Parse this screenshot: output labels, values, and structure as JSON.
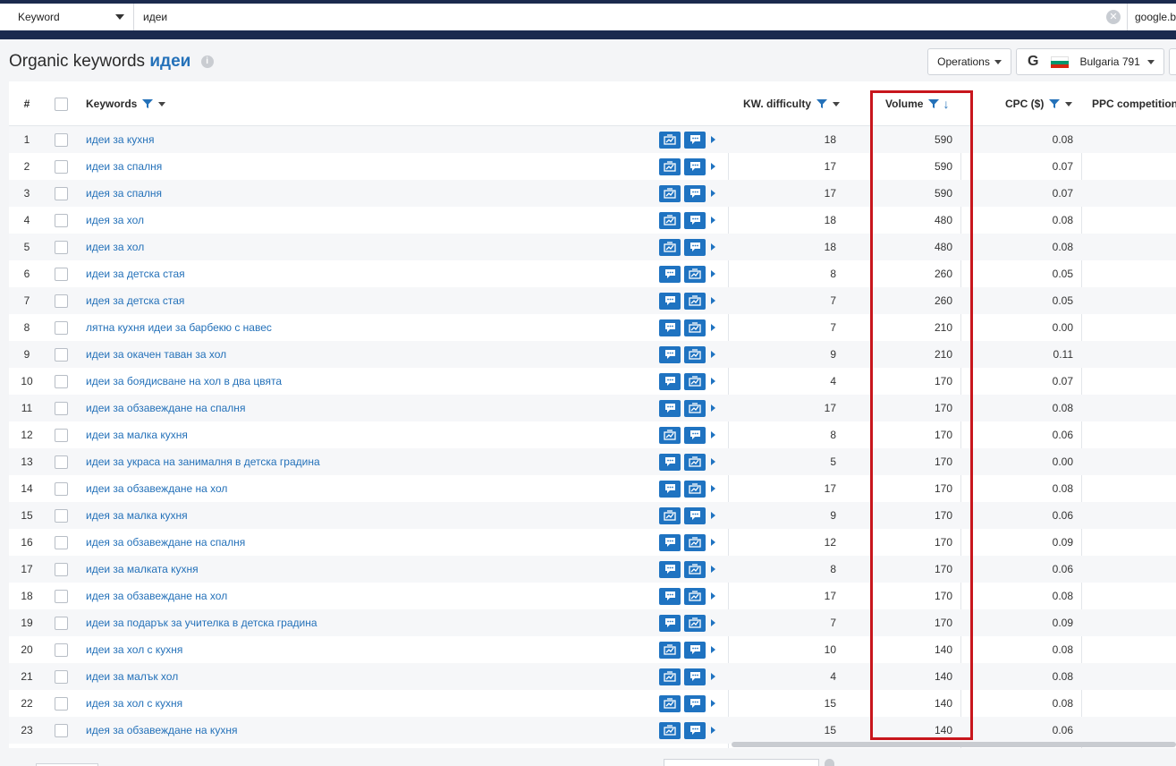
{
  "search": {
    "type_label": "Keyword",
    "query": "идеи",
    "engine_partial": "google.b"
  },
  "title": {
    "prefix": "Organic keywords",
    "keyword": "идеи"
  },
  "toolbar": {
    "operations_label": "Operations",
    "region_label": "Bulgaria 791"
  },
  "colors": {
    "accent": "#2471b9",
    "action_button": "#1f73c1",
    "highlight_box": "#c8161d",
    "topbar": "#1b2a4e"
  },
  "columns": {
    "num": "#",
    "keywords": "Keywords",
    "difficulty": "KW. difficulty",
    "volume": "Volume",
    "cpc": "CPC ($)",
    "ppc": "PPC competition,"
  },
  "rows": [
    {
      "n": "1",
      "kw": "идеи за кухня",
      "d": "18",
      "v": "590",
      "c": "0.08",
      "icons": [
        "chart-icon",
        "comment-icon"
      ]
    },
    {
      "n": "2",
      "kw": "идеи за спалня",
      "d": "17",
      "v": "590",
      "c": "0.07",
      "icons": [
        "chart-icon",
        "comment-icon"
      ]
    },
    {
      "n": "3",
      "kw": "идея за спалня",
      "d": "17",
      "v": "590",
      "c": "0.07",
      "icons": [
        "chart-icon",
        "comment-icon"
      ]
    },
    {
      "n": "4",
      "kw": "идея за хол",
      "d": "18",
      "v": "480",
      "c": "0.08",
      "icons": [
        "chart-icon",
        "comment-icon"
      ]
    },
    {
      "n": "5",
      "kw": "идеи за хол",
      "d": "18",
      "v": "480",
      "c": "0.08",
      "icons": [
        "chart-icon",
        "comment-icon"
      ]
    },
    {
      "n": "6",
      "kw": "идеи за детска стая",
      "d": "8",
      "v": "260",
      "c": "0.05",
      "icons": [
        "comment-icon",
        "chart-icon"
      ]
    },
    {
      "n": "7",
      "kw": "идея за детска стая",
      "d": "7",
      "v": "260",
      "c": "0.05",
      "icons": [
        "comment-icon",
        "chart-icon"
      ]
    },
    {
      "n": "8",
      "kw": "лятна кухня идеи за барбекю с навес",
      "d": "7",
      "v": "210",
      "c": "0.00",
      "icons": [
        "comment-icon",
        "chart-icon"
      ]
    },
    {
      "n": "9",
      "kw": "идеи за окачен таван за хол",
      "d": "9",
      "v": "210",
      "c": "0.11",
      "icons": [
        "comment-icon",
        "chart-icon"
      ]
    },
    {
      "n": "10",
      "kw": "идеи за боядисване на хол в два цвята",
      "d": "4",
      "v": "170",
      "c": "0.07",
      "icons": [
        "comment-icon",
        "chart-icon"
      ]
    },
    {
      "n": "11",
      "kw": "идеи за обзавеждане на спалня",
      "d": "17",
      "v": "170",
      "c": "0.08",
      "icons": [
        "comment-icon",
        "chart-icon"
      ]
    },
    {
      "n": "12",
      "kw": "идеи за малка кухня",
      "d": "8",
      "v": "170",
      "c": "0.06",
      "icons": [
        "chart-icon",
        "comment-icon"
      ]
    },
    {
      "n": "13",
      "kw": "идеи за украса на занималня в детска градина",
      "d": "5",
      "v": "170",
      "c": "0.00",
      "icons": [
        "comment-icon",
        "chart-icon"
      ]
    },
    {
      "n": "14",
      "kw": "идеи за обзавеждане на хол",
      "d": "17",
      "v": "170",
      "c": "0.08",
      "icons": [
        "comment-icon",
        "chart-icon"
      ]
    },
    {
      "n": "15",
      "kw": "идея за малка кухня",
      "d": "9",
      "v": "170",
      "c": "0.06",
      "icons": [
        "chart-icon",
        "comment-icon"
      ]
    },
    {
      "n": "16",
      "kw": "идея за обзавеждане на спалня",
      "d": "12",
      "v": "170",
      "c": "0.09",
      "icons": [
        "comment-icon",
        "chart-icon"
      ]
    },
    {
      "n": "17",
      "kw": "идеи за малката кухня",
      "d": "8",
      "v": "170",
      "c": "0.06",
      "icons": [
        "comment-icon",
        "chart-icon"
      ]
    },
    {
      "n": "18",
      "kw": "идея за обзавеждане на хол",
      "d": "17",
      "v": "170",
      "c": "0.08",
      "icons": [
        "comment-icon",
        "chart-icon"
      ]
    },
    {
      "n": "19",
      "kw": "идеи за подарък за учителка в детска градина",
      "d": "7",
      "v": "170",
      "c": "0.09",
      "icons": [
        "comment-icon",
        "chart-icon"
      ]
    },
    {
      "n": "20",
      "kw": "идеи за хол с кухня",
      "d": "10",
      "v": "140",
      "c": "0.08",
      "icons": [
        "chart-icon",
        "comment-icon"
      ]
    },
    {
      "n": "21",
      "kw": "идеи за малък хол",
      "d": "4",
      "v": "140",
      "c": "0.08",
      "icons": [
        "chart-icon",
        "comment-icon"
      ]
    },
    {
      "n": "22",
      "kw": "идея за хол с кухня",
      "d": "15",
      "v": "140",
      "c": "0.08",
      "icons": [
        "chart-icon",
        "comment-icon"
      ]
    },
    {
      "n": "23",
      "kw": "идея за обзавеждане на кухня",
      "d": "15",
      "v": "140",
      "c": "0.06",
      "icons": [
        "chart-icon",
        "comment-icon"
      ]
    }
  ]
}
